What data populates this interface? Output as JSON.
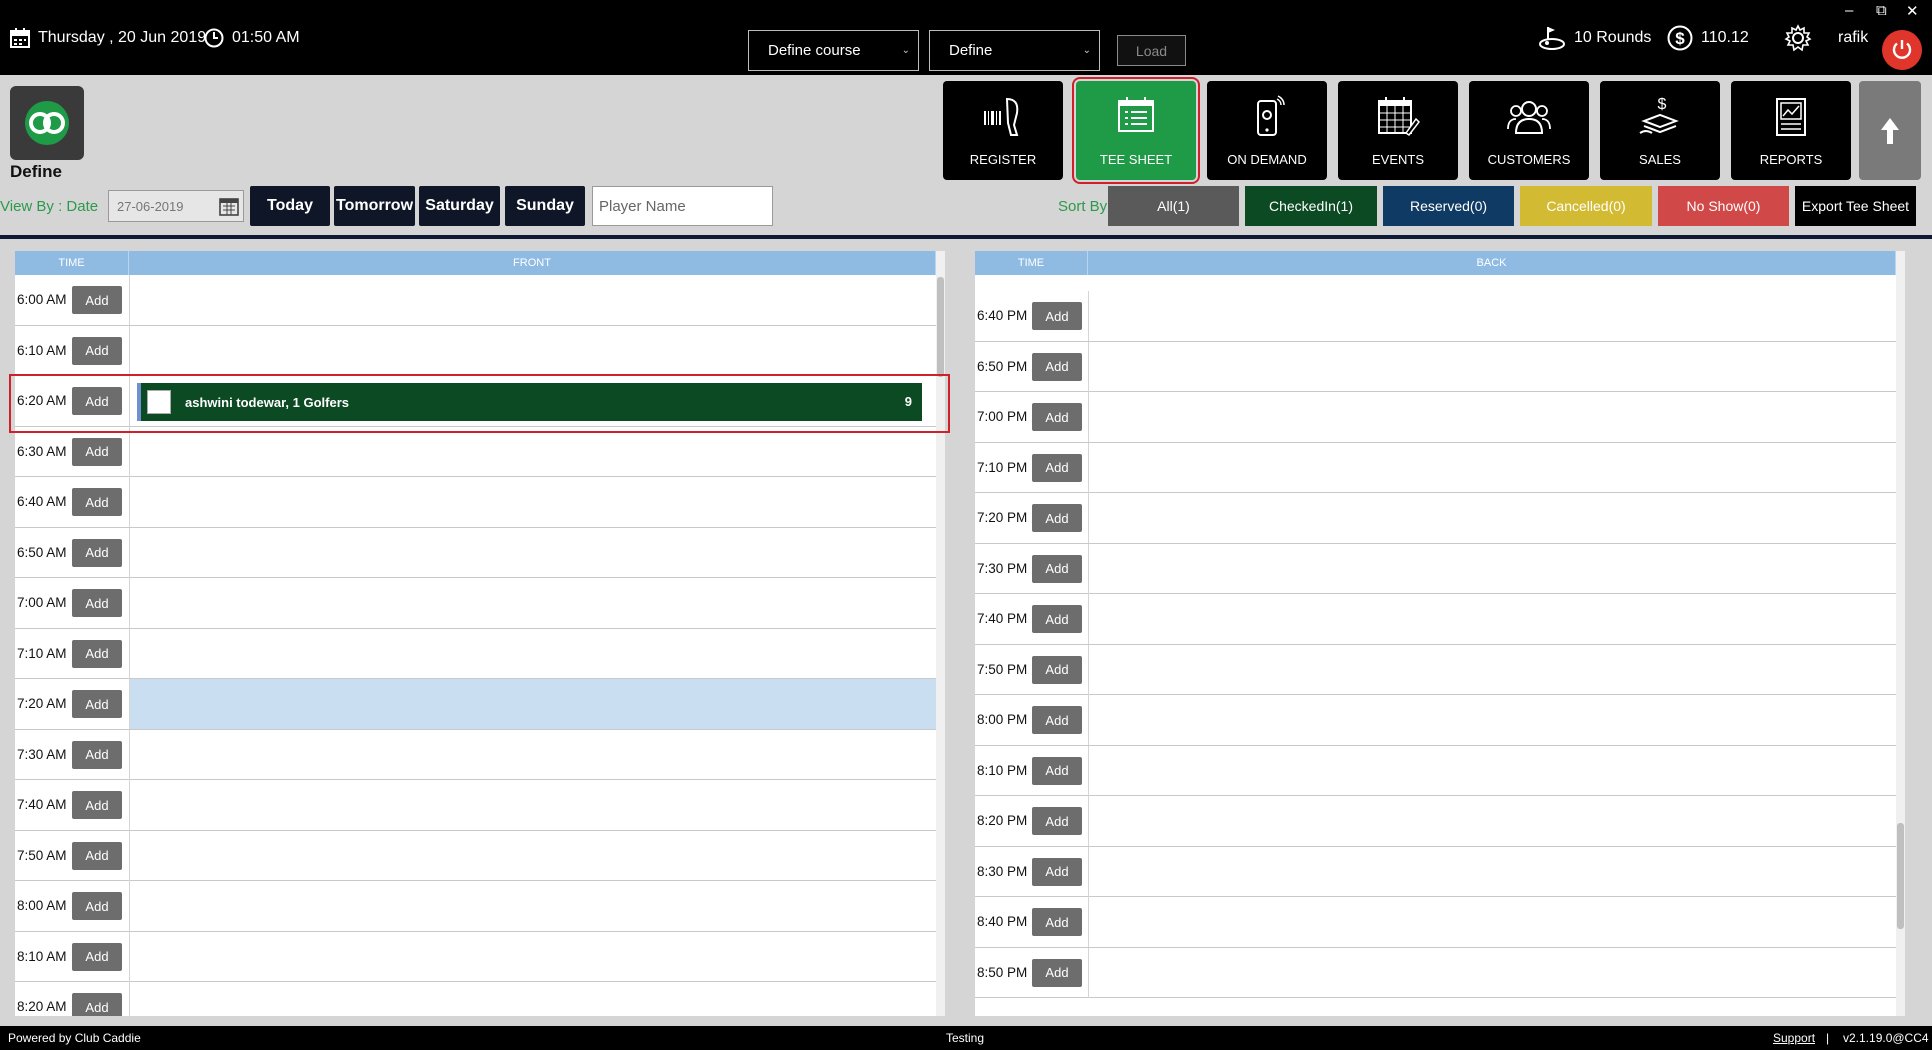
{
  "topbar": {
    "date": "Thursday ,  20 Jun 2019",
    "time": "01:50 AM",
    "course_dropdown": "Define course",
    "define_dropdown": "Define",
    "load_label": "Load",
    "rounds": "10 Rounds",
    "balance": "110.12",
    "user": "rafik",
    "min_glyph": "–",
    "restore_glyph": "⧉",
    "close_glyph": "✕"
  },
  "logo": {
    "label": "Define"
  },
  "nav": [
    {
      "label": "REGISTER",
      "icon": "barcode-scanner-icon"
    },
    {
      "label": "TEE SHEET",
      "icon": "tee-sheet-icon",
      "active": true
    },
    {
      "label": "ON DEMAND",
      "icon": "mobile-icon"
    },
    {
      "label": "EVENTS",
      "icon": "calendar-edit-icon"
    },
    {
      "label": "CUSTOMERS",
      "icon": "customers-icon"
    },
    {
      "label": "SALES",
      "icon": "sales-icon"
    },
    {
      "label": "REPORTS",
      "icon": "reports-icon"
    }
  ],
  "filters": {
    "view_by": "View By : Date",
    "date_value": "27-06-2019",
    "days": [
      "Today",
      "Tomorrow",
      "Saturday",
      "Sunday"
    ],
    "player_placeholder": "Player Name",
    "sort_by": "Sort By",
    "status": [
      {
        "label": "All(1)",
        "color": "#5a5a5a"
      },
      {
        "label": "CheckedIn(1)",
        "color": "#0c4a23"
      },
      {
        "label": "Reserved(0)",
        "color": "#0f3a63"
      },
      {
        "label": "Cancelled(0)",
        "color": "#d2bb32"
      },
      {
        "label": "No Show(0)",
        "color": "#d04848"
      }
    ],
    "export_label": "Export Tee Sheet"
  },
  "front": {
    "time_header": "TIME",
    "header": "FRONT",
    "times": [
      "6:00 AM",
      "6:10 AM",
      "6:20 AM",
      "6:30 AM",
      "6:40 AM",
      "6:50 AM",
      "7:00 AM",
      "7:10 AM",
      "7:20 AM",
      "7:30 AM",
      "7:40 AM",
      "7:50 AM",
      "8:00 AM",
      "8:10 AM",
      "8:20 AM"
    ],
    "add_label": "Add",
    "booking": {
      "name": "ashwini todewar, 1 Golfers",
      "count": "9"
    }
  },
  "back": {
    "time_header": "TIME",
    "header": "BACK",
    "times": [
      "6:40 PM",
      "6:50 PM",
      "7:00 PM",
      "7:10 PM",
      "7:20 PM",
      "7:30 PM",
      "7:40 PM",
      "7:50 PM",
      "8:00 PM",
      "8:10 PM",
      "8:20 PM",
      "8:30 PM",
      "8:40 PM",
      "8:50 PM"
    ],
    "add_label": "Add"
  },
  "footer": {
    "powered": "Powered by Club Caddie",
    "center": "Testing",
    "support": "Support",
    "sep": "|",
    "version": "v2.1.19.0@CC4"
  }
}
